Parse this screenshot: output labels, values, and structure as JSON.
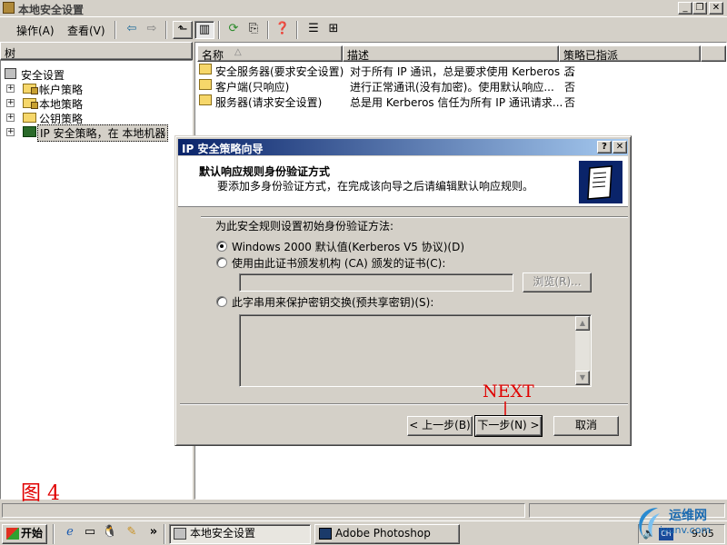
{
  "window": {
    "title": "本地安全设置"
  },
  "menu": {
    "action": "操作(A)",
    "view": "查看(V)"
  },
  "tree": {
    "header": "树",
    "items": [
      {
        "label": "安全设置"
      },
      {
        "label": "帐户策略"
      },
      {
        "label": "本地策略"
      },
      {
        "label": "公钥策略"
      },
      {
        "label": "IP 安全策略，在 本地机器"
      }
    ]
  },
  "list": {
    "columns": [
      "名称",
      "描述",
      "策略已指派"
    ],
    "rows": [
      {
        "name": "安全服务器(要求安全设置)",
        "desc": "对于所有 IP 通讯，总是要求使用 Kerberos ...",
        "assigned": "否"
      },
      {
        "name": "客户端(只响应)",
        "desc": "进行正常通讯(没有加密)。使用默认响应...",
        "assigned": "否"
      },
      {
        "name": "服务器(请求安全设置)",
        "desc": "总是用 Kerberos 信任为所有 IP 通讯请求...",
        "assigned": "否"
      }
    ]
  },
  "dialog": {
    "title": "IP 安全策略向导",
    "help": "?",
    "close": "✕",
    "heading": "默认响应规则身份验证方式",
    "subheading": "要添加多身份验证方式，在完成该向导之后请编辑默认响应规则。",
    "prompt": "为此安全规则设置初始身份验证方法:",
    "option1": "Windows 2000 默认值(Kerberos V5 协议)(D)",
    "option2": "使用由此证书颁发机构 (CA) 颁发的证书(C):",
    "option3": "此字串用来保护密钥交换(预共享密钥)(S):",
    "browse": "浏览(R)...",
    "back": "< 上一步(B)",
    "next": "下一步(N) >",
    "cancel": "取消"
  },
  "annotation": {
    "next_label": "NEXT",
    "figure_label": "图 4"
  },
  "taskbar": {
    "start": "开始",
    "task1": "本地安全设置",
    "task2": "Adobe Photoshop",
    "clock": "9:05"
  },
  "watermark": {
    "text": "运维网",
    "url": "iyunv.com"
  },
  "colors": {
    "title_active": "#0a246a",
    "annotation_red": "#e00000"
  }
}
